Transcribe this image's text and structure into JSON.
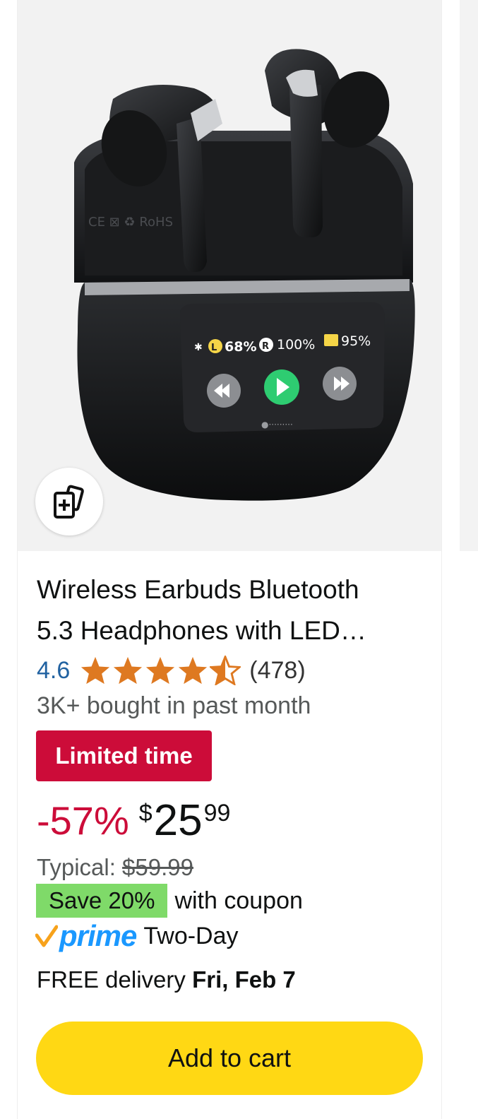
{
  "product": {
    "title_line1": "Wireless Earbuds Bluetooth",
    "title_line2": "5.3 Headphones with LED…",
    "image_icon": "earbuds-product-photo",
    "case_display": {
      "left_bud": "68%",
      "left_label": "L",
      "right_bud": "100%",
      "right_label": "R",
      "case_battery": "95%"
    }
  },
  "compare_icon": "add-to-compare-icon",
  "rating": {
    "value": "4.6",
    "stars": 4.6,
    "star_color": "#de7921",
    "reviews": "(478)"
  },
  "social_proof": "3K+ bought in past month",
  "deal_badge": {
    "label": "Limited time",
    "color": "#cc0c39"
  },
  "pricing": {
    "discount": "-57%",
    "symbol": "$",
    "whole": "25",
    "fraction": "99",
    "typical_label": "Typical: ",
    "typical_price": "$59.99"
  },
  "coupon": {
    "badge": "Save 20%",
    "text": "with coupon",
    "color": "#7fda69"
  },
  "prime": {
    "logo_text": "prime",
    "speed": "Two-Day",
    "color": "#1a98ff"
  },
  "delivery": {
    "prefix": "FREE delivery ",
    "date": "Fri, Feb 7"
  },
  "cart_button": {
    "label": "Add to cart",
    "color": "#ffd814"
  }
}
